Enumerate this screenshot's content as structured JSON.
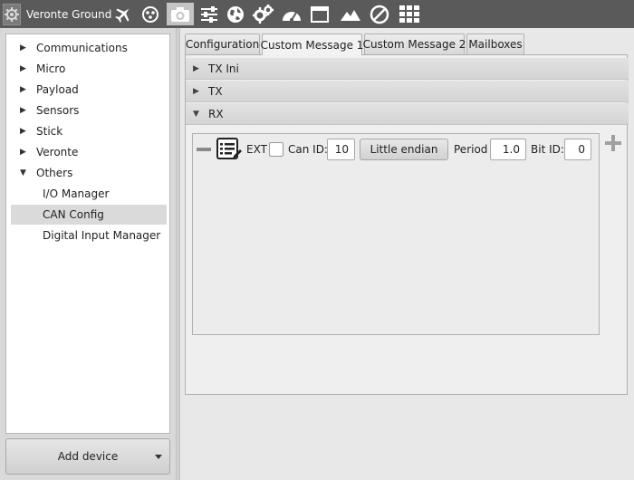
{
  "app": {
    "title": "Veronte Ground",
    "logo_icon": "gear-icon"
  },
  "toolbar": {
    "tools": [
      {
        "name": "airplane-icon",
        "active": false
      },
      {
        "name": "connections-icon",
        "active": false
      },
      {
        "name": "camera-icon",
        "active": true
      },
      {
        "name": "sliders-icon",
        "active": false
      },
      {
        "name": "globe-icon",
        "active": false
      },
      {
        "name": "gears-icon",
        "active": false
      },
      {
        "name": "dashboard-icon",
        "active": false
      },
      {
        "name": "window-icon",
        "active": false
      },
      {
        "name": "mountain-icon",
        "active": false
      },
      {
        "name": "forbidden-icon",
        "active": false
      },
      {
        "name": "grid-icon",
        "active": false
      }
    ]
  },
  "sidebar": {
    "items": [
      {
        "label": "Communications",
        "expanded": false
      },
      {
        "label": "Micro",
        "expanded": false
      },
      {
        "label": "Payload",
        "expanded": false
      },
      {
        "label": "Sensors",
        "expanded": false
      },
      {
        "label": "Stick",
        "expanded": false
      },
      {
        "label": "Veronte",
        "expanded": false
      },
      {
        "label": "Others",
        "expanded": true
      }
    ],
    "children": [
      {
        "label": "I/O Manager",
        "selected": false
      },
      {
        "label": "CAN Config",
        "selected": true
      },
      {
        "label": "Digital Input Manager",
        "selected": false
      }
    ],
    "add_device_label": "Add device"
  },
  "tabs": [
    {
      "label": "Configuration",
      "active": false
    },
    {
      "label": "Custom Message 1",
      "active": true
    },
    {
      "label": "Custom Message 2",
      "active": false
    },
    {
      "label": "Mailboxes",
      "active": false
    }
  ],
  "sections": [
    {
      "label": "TX Ini",
      "expanded": false
    },
    {
      "label": "TX",
      "expanded": false
    },
    {
      "label": "RX",
      "expanded": true
    }
  ],
  "rx_row": {
    "ext_label": "EXT",
    "ext_checked": false,
    "can_id_label": "Can ID:",
    "can_id_value": "10",
    "endian_button": "Little endian",
    "period_label": "Period",
    "period_value": "1.0",
    "bit_id_label": "Bit ID:",
    "bit_id_value": "0"
  },
  "colors": {
    "toolbar_bg": "#5a5a5a",
    "selected_row_bg": "#dadada",
    "panel_bg": "#e8e8e8"
  }
}
